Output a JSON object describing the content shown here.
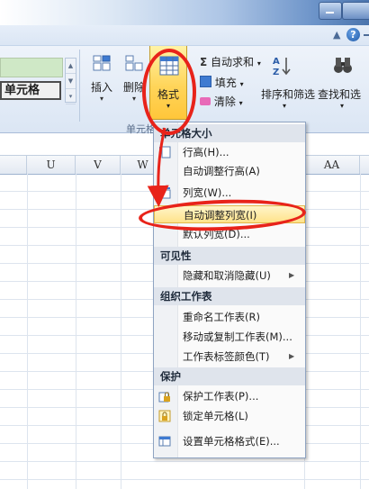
{
  "help_row": {
    "help_icon": "?"
  },
  "ribbon": {
    "cell_style_label": "单元格",
    "insert_label": "插入",
    "delete_label": "删除",
    "format_label": "格式",
    "group_label": "单元格",
    "autosum_label": "自动求和",
    "fill_label": "填充",
    "clear_label": "清除",
    "sort_filter_label": "排序和筛选",
    "find_select_label": "查找和选"
  },
  "columns": [
    "U",
    "V",
    "W",
    "",
    "AA"
  ],
  "menu": {
    "section_cell_size": "单元格大小",
    "row_height": "行高(H)...",
    "autofit_row_height": "自动调整行高(A)",
    "column_width": "列宽(W)...",
    "autofit_column_width": "自动调整列宽(I)",
    "default_width": "默认列宽(D)...",
    "section_visibility": "可见性",
    "hide_unhide": "隐藏和取消隐藏(U)",
    "section_organize": "组织工作表",
    "rename_sheet": "重命名工作表(R)",
    "move_copy_sheet": "移动或复制工作表(M)...",
    "tab_color": "工作表标签颜色(T)",
    "section_protect": "保护",
    "protect_sheet": "保护工作表(P)...",
    "lock_cell": "锁定单元格(L)",
    "format_cells": "设置单元格格式(E)..."
  },
  "colors": {
    "annotation": "#e8231a",
    "highlight": "#ffe38a",
    "ribbon": "#dbe6f4"
  }
}
